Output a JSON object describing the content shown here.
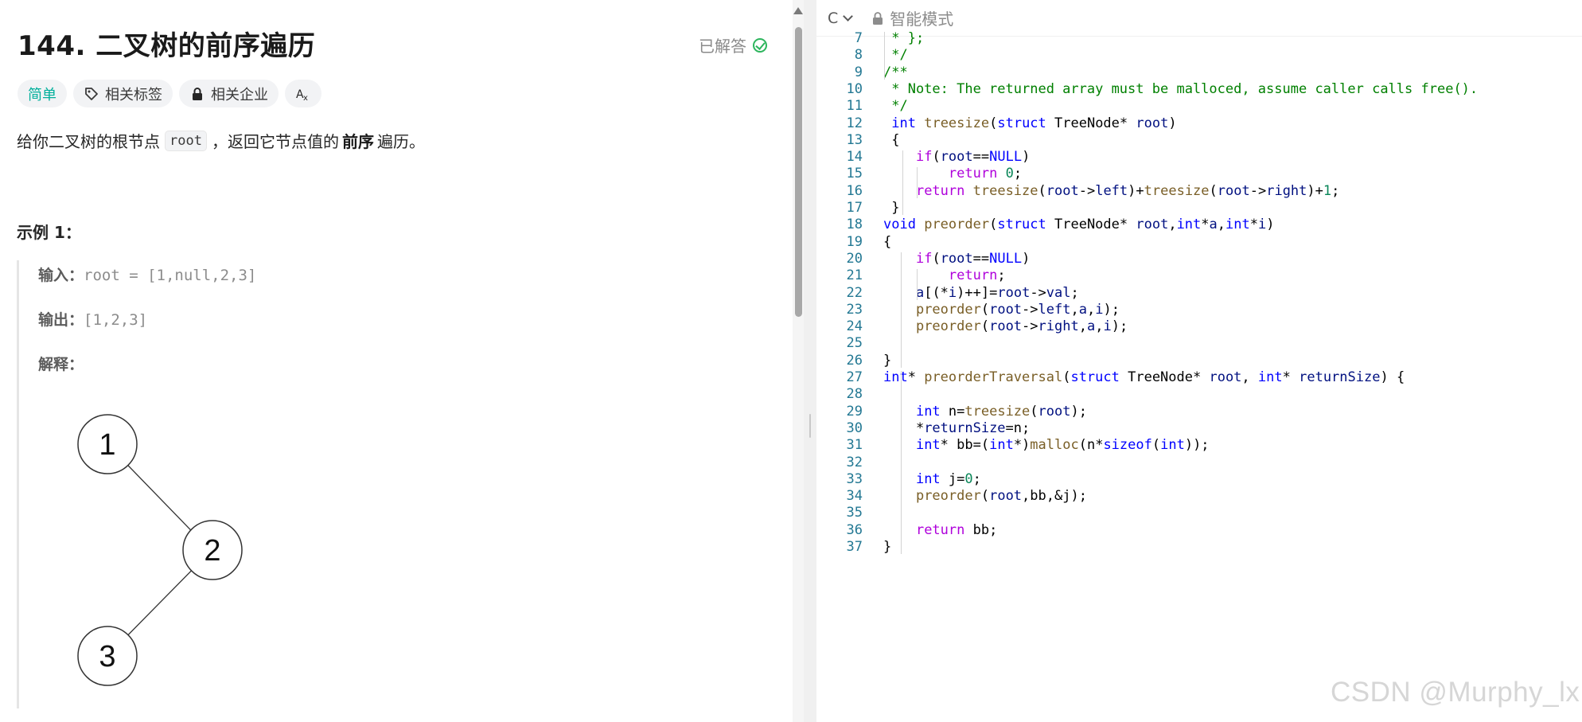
{
  "problem": {
    "title": "144. 二叉树的前序遍历",
    "solved_label": "已解答",
    "tags": {
      "difficulty": "简单",
      "topics": "相关标签",
      "companies": "相关企业",
      "translate": "Aあ"
    },
    "description": {
      "before": "给你二叉树的根节点",
      "code": "root",
      "middle": "，返回它节点值的",
      "bold": "前序",
      "after": "遍历。"
    },
    "example": {
      "title": "示例 1：",
      "input_label": "输入：",
      "input_value": "root = [1,null,2,3]",
      "output_label": "输出：",
      "output_value": "[1,2,3]",
      "explanation_label": "解释："
    },
    "tree_nodes": [
      "1",
      "2",
      "3"
    ]
  },
  "editor": {
    "language": "C",
    "mode": "智能模式",
    "lines": [
      {
        "n": "7",
        "text": " * };"
      },
      {
        "n": "8",
        "text": " */"
      },
      {
        "n": "9",
        "text": "/**"
      },
      {
        "n": "10",
        "text": " * Note: The returned array must be malloced, assume caller calls free()."
      },
      {
        "n": "11",
        "text": " */"
      },
      {
        "n": "12",
        "text": " int treesize(struct TreeNode* root)"
      },
      {
        "n": "13",
        "text": " {"
      },
      {
        "n": "14",
        "text": "    if(root==NULL)"
      },
      {
        "n": "15",
        "text": "        return 0;"
      },
      {
        "n": "16",
        "text": "    return treesize(root->left)+treesize(root->right)+1;"
      },
      {
        "n": "17",
        "text": " }"
      },
      {
        "n": "18",
        "text": "void preorder(struct TreeNode* root,int*a,int*i)"
      },
      {
        "n": "19",
        "text": "{"
      },
      {
        "n": "20",
        "text": "    if(root==NULL)"
      },
      {
        "n": "21",
        "text": "        return;"
      },
      {
        "n": "22",
        "text": "    a[(*i)++]=root->val;"
      },
      {
        "n": "23",
        "text": "    preorder(root->left,a,i);"
      },
      {
        "n": "24",
        "text": "    preorder(root->right,a,i);"
      },
      {
        "n": "25",
        "text": ""
      },
      {
        "n": "26",
        "text": "}"
      },
      {
        "n": "27",
        "text": "int* preorderTraversal(struct TreeNode* root, int* returnSize) {"
      },
      {
        "n": "28",
        "text": ""
      },
      {
        "n": "29",
        "text": "    int n=treesize(root);"
      },
      {
        "n": "30",
        "text": "    *returnSize=n;"
      },
      {
        "n": "31",
        "text": "    int* bb=(int*)malloc(n*sizeof(int));"
      },
      {
        "n": "32",
        "text": ""
      },
      {
        "n": "33",
        "text": "    int j=0;"
      },
      {
        "n": "34",
        "text": "    preorder(root,bb,&j);"
      },
      {
        "n": "35",
        "text": ""
      },
      {
        "n": "36",
        "text": "    return bb;"
      },
      {
        "n": "37",
        "text": "}"
      }
    ]
  },
  "watermark": "CSDN @Murphy_lx",
  "colors": {
    "difficulty_easy": "#00af9b",
    "solved_check": "#2db55d",
    "keyword": "#0000ff",
    "comment": "#008000",
    "function": "#795e26",
    "control": "#af00db",
    "line_number": "#237893"
  }
}
